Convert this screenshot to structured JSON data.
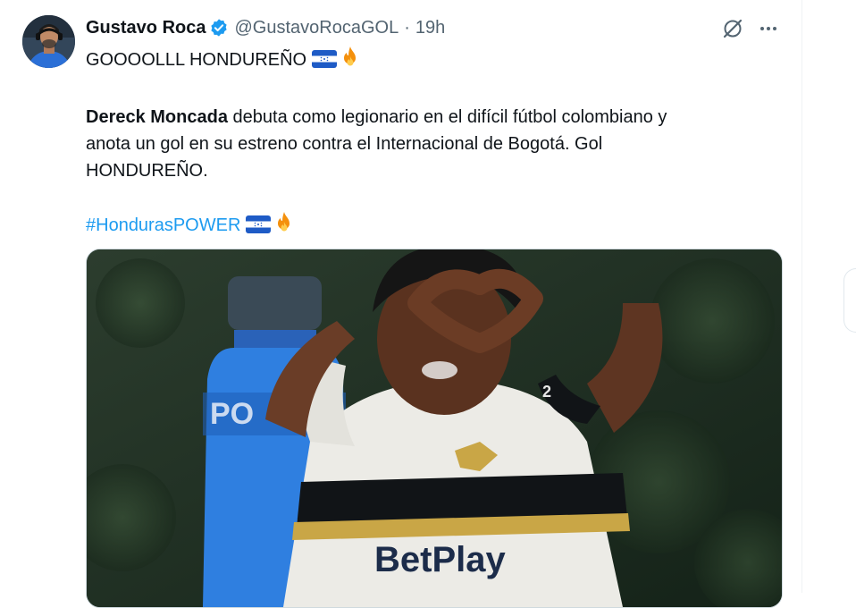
{
  "tweet": {
    "author_name": "Gustavo Roca",
    "handle": "@GustavoRocaGOL",
    "separator": "·",
    "time": "19h",
    "line1": "GOOOOLLL HONDUREÑO",
    "bold_name": "Dereck Moncada",
    "line2_rest": " debuta como legionario en el difícil fútbol colombiano y",
    "line3": "anota un gol en su estreno contra el Internacional de Bogotá. Gol",
    "line4": "HONDUREÑO.",
    "hashtag": "#HondurasPOWER"
  },
  "media": {
    "bottle_text": "PO",
    "sponsor_text": "BetPlay",
    "jersey_number": "2"
  },
  "icons": {
    "verified": "verified-badge-icon",
    "grok": "grok-icon",
    "more": "more-dots-icon",
    "flag": "honduras-flag-icon",
    "fire": "fire-icon"
  },
  "colors": {
    "link": "#1d9bf0",
    "text": "#0f1419",
    "muted": "#536471",
    "verified": "#1d9bf0"
  }
}
